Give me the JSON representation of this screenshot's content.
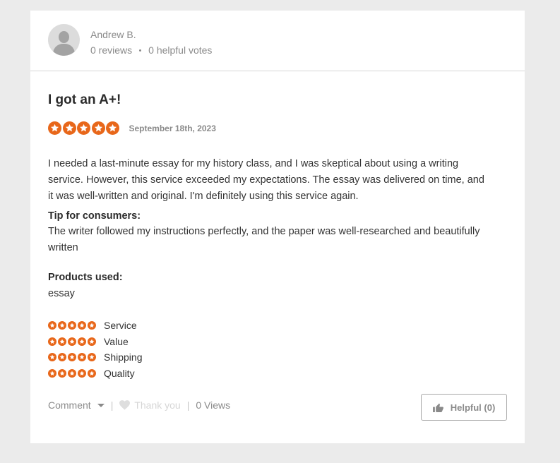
{
  "reviewer": {
    "name": "Andrew B.",
    "reviews": "0 reviews",
    "helpful_votes": "0 helpful votes"
  },
  "review": {
    "title": "I got an A+!",
    "rating": 5,
    "date": "September 18th, 2023",
    "body_lines": [
      "I needed a last-minute essay for my history class, and I was skeptical about using a writing",
      "service. However, this service exceeded my expectations. The essay was delivered on time, and",
      "it was well-written and original. I'm definitely using this service again."
    ],
    "tip_label": "Tip for consumers:",
    "tip_lines": [
      "The writer followed my instructions perfectly, and the paper was well-researched and beautifully",
      "written"
    ],
    "products_label": "Products used:",
    "products": "essay"
  },
  "sub_ratings": [
    {
      "label": "Service",
      "rating": 5
    },
    {
      "label": "Value",
      "rating": 5
    },
    {
      "label": "Shipping",
      "rating": 5
    },
    {
      "label": "Quality",
      "rating": 5
    }
  ],
  "footer": {
    "comment": "Comment",
    "thank_you": "Thank you",
    "views": "0 Views",
    "helpful": "Helpful (0)"
  },
  "colors": {
    "star": "#e8671a",
    "background": "#ebebeb"
  }
}
